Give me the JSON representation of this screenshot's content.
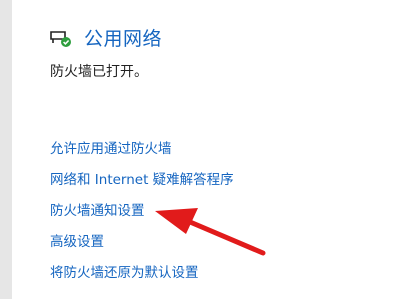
{
  "network": {
    "icon": "network-shield-icon",
    "title": "公用网络",
    "status": "防火墙已打开。"
  },
  "links": [
    {
      "label": "允许应用通过防火墙"
    },
    {
      "label": "网络和 Internet 疑难解答程序"
    },
    {
      "label": "防火墙通知设置"
    },
    {
      "label": "高级设置"
    },
    {
      "label": "将防火墙还原为默认设置"
    }
  ],
  "annotation": {
    "icon": "red-arrow-icon",
    "color": "#e11b1b"
  },
  "colors": {
    "link": "#1565c0",
    "sidebar": "#e6e6e6"
  }
}
